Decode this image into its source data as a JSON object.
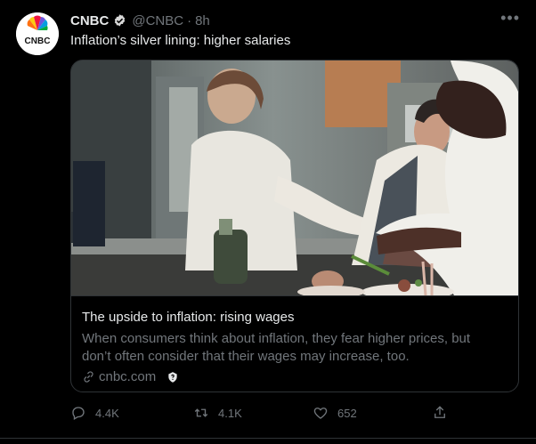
{
  "account": {
    "name": "CNBC",
    "handle": "@CNBC",
    "separator": "·",
    "time": "8h",
    "verified": true,
    "logo_text": "CNBC"
  },
  "tweet": {
    "text": "Inflation’s silver lining: higher salaries"
  },
  "card": {
    "title": "The upside to inflation: rising wages",
    "description": "When consumers think about inflation, they fear higher prices, but don’t often consider that their wages may increase, too.",
    "domain": "cnbc.com"
  },
  "actions": {
    "replies": "4.4K",
    "retweets": "4.1K",
    "likes": "652"
  },
  "colors": {
    "background": "#000000",
    "text": "#e7e9ea",
    "muted": "#71767b",
    "border": "#2f3336",
    "verified": "#d9d9d9"
  }
}
